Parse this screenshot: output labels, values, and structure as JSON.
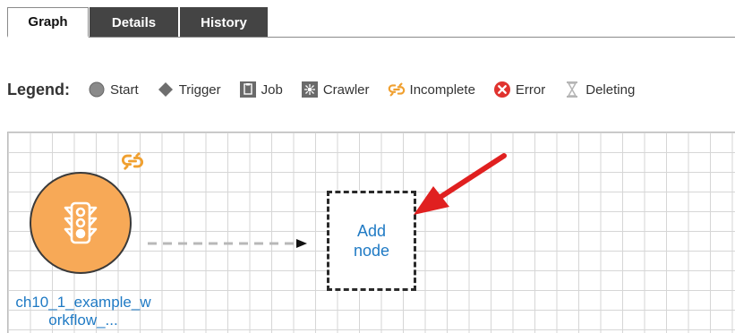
{
  "tabs": [
    {
      "label": "Graph",
      "active": true
    },
    {
      "label": "Details",
      "active": false
    },
    {
      "label": "History",
      "active": false
    }
  ],
  "legend": {
    "title": "Legend:",
    "items": [
      {
        "label": "Start",
        "icon": "circle-icon"
      },
      {
        "label": "Trigger",
        "icon": "diamond-icon"
      },
      {
        "label": "Job",
        "icon": "job-icon"
      },
      {
        "label": "Crawler",
        "icon": "crawler-icon"
      },
      {
        "label": "Incomplete",
        "icon": "broken-link-icon"
      },
      {
        "label": "Error",
        "icon": "error-icon"
      },
      {
        "label": "Deleting",
        "icon": "hourglass-icon"
      }
    ]
  },
  "graph": {
    "start_node": {
      "label": "ch10_1_example_workflow_...",
      "icon": "traffic-light-icon"
    },
    "add_node": {
      "label": "Add node"
    }
  },
  "colors": {
    "start_fill": "#f7a957",
    "incomplete": "#f0a030",
    "error": "#e0332f",
    "link": "#1f7ac4",
    "annotation_arrow": "#e02020"
  }
}
